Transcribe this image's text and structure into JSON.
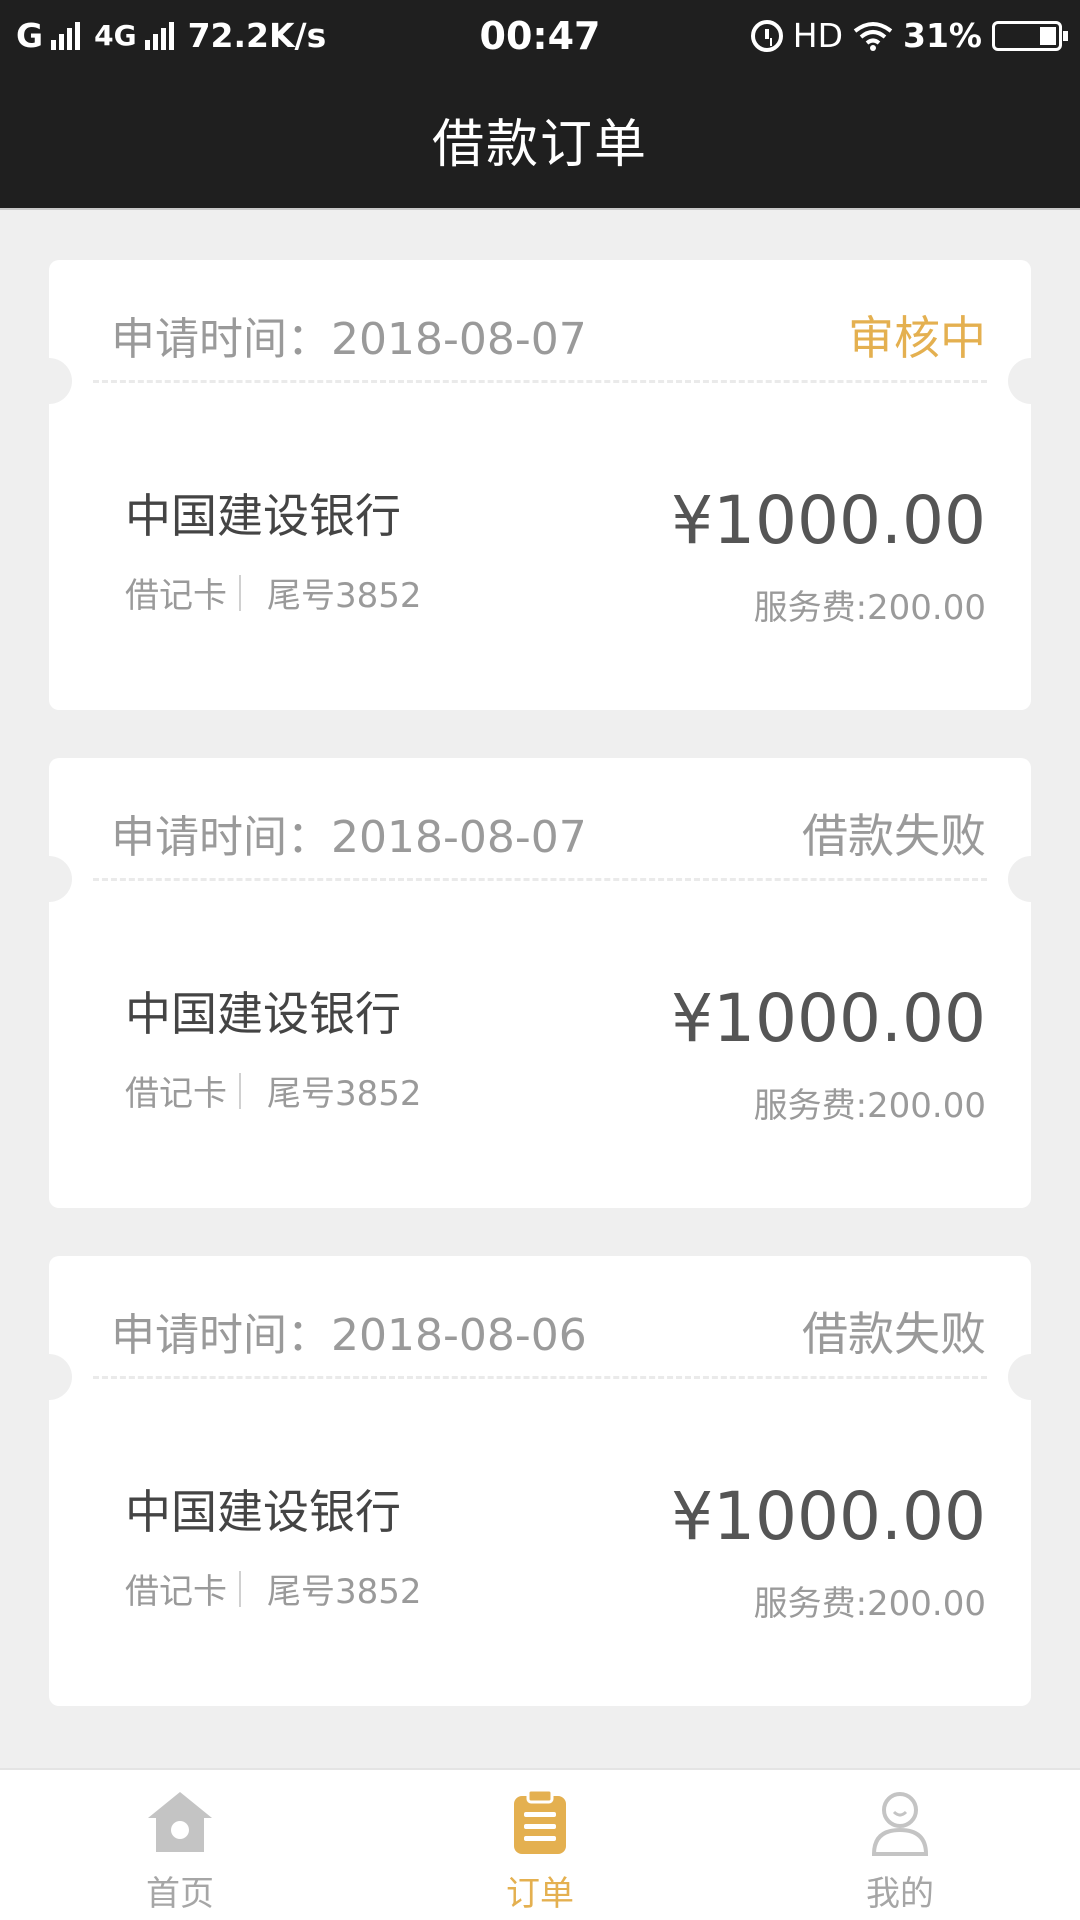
{
  "status_bar": {
    "carrier1": "G",
    "carrier2": "4G",
    "speed": "72.2K/s",
    "time": "00:47",
    "hd": "HD",
    "battery": "31%"
  },
  "header": {
    "title": "借款订单"
  },
  "orders": [
    {
      "date": "申请时间：2018-08-07",
      "status": "审核中",
      "bank": "中国建设银行",
      "card_type": "借记卡",
      "card_tail": "尾号3852",
      "amount": "¥1000.00",
      "fee": "服务费:200.00"
    },
    {
      "date": "申请时间：2018-08-07",
      "status": "借款失败",
      "bank": "中国建设银行",
      "card_type": "借记卡",
      "card_tail": "尾号3852",
      "amount": "¥1000.00",
      "fee": "服务费:200.00"
    },
    {
      "date": "申请时间：2018-08-06",
      "status": "借款失败",
      "bank": "中国建设银行",
      "card_type": "借记卡",
      "card_tail": "尾号3852",
      "amount": "¥1000.00",
      "fee": "服务费:200.00"
    }
  ],
  "tabs": [
    {
      "label": "首页",
      "icon": "home-icon",
      "active": false
    },
    {
      "label": "订单",
      "icon": "clipboard-icon",
      "active": true
    },
    {
      "label": "我的",
      "icon": "user-icon",
      "active": false
    }
  ],
  "colors": {
    "accent": "#e4b050",
    "header_bg": "#1f1f1f",
    "page_bg": "#efefef"
  }
}
